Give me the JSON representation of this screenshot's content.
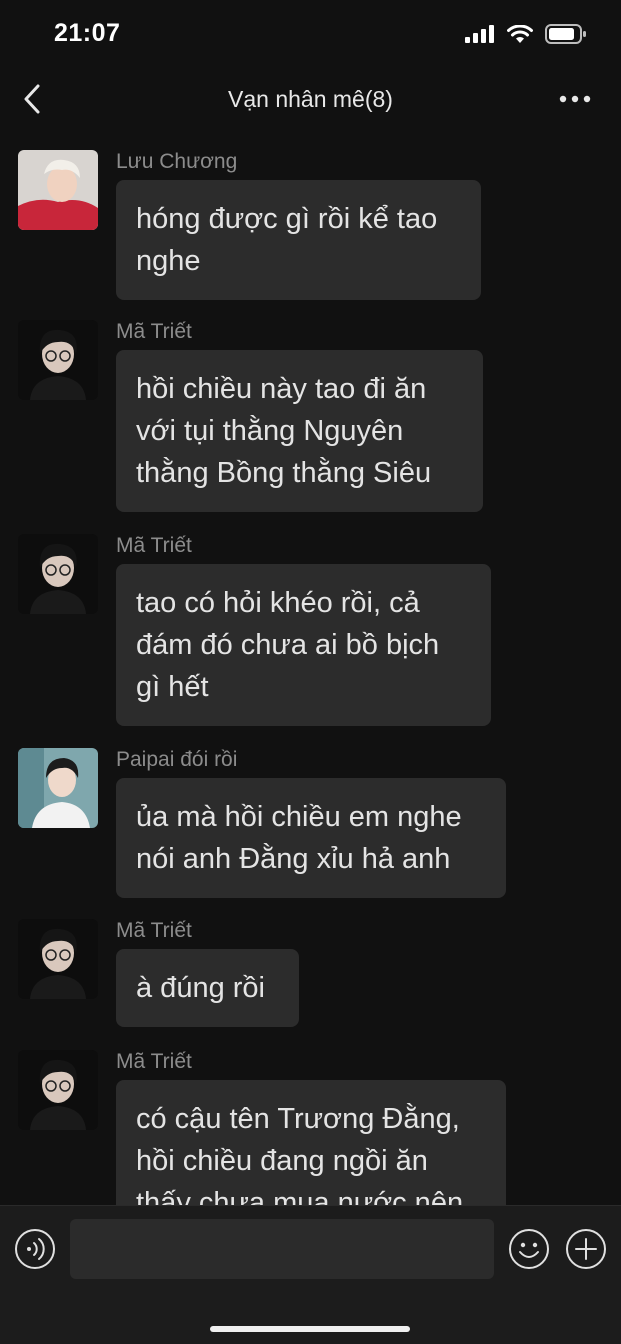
{
  "status_bar": {
    "time": "21:07",
    "icons": [
      "signal-icon",
      "wifi-icon",
      "battery-icon"
    ]
  },
  "nav": {
    "title": "Vạn nhân mê(8)",
    "back_icon": "chevron-left-icon",
    "more_icon": "more-dots-icon"
  },
  "colors": {
    "background": "#111111",
    "bubble": "#2c2c2c",
    "sender_text": "#8c8c8c",
    "message_text": "#e4e4e4",
    "input_bar": "#1c1c1c"
  },
  "messages": [
    {
      "sender": "Lưu Chương",
      "avatar": "avatar-red-hoodie",
      "lines": [
        "hóng được gì rồi kể tao",
        "nghe"
      ]
    },
    {
      "sender": "Mã Triết",
      "avatar": "avatar-glasses",
      "lines": [
        "hồi chiều này tao đi ăn",
        "với tụi thằng Nguyên",
        "thằng Bồng thằng Siêu"
      ]
    },
    {
      "sender": "Mã Triết",
      "avatar": "avatar-glasses",
      "lines": [
        "tao có hỏi khéo rồi, cả",
        "đám đó chưa ai bồ bịch",
        "gì hết"
      ]
    },
    {
      "sender": "Paipai đói rồi",
      "avatar": "avatar-white-shirt",
      "lines": [
        "ủa mà hồi chiều em nghe",
        "nói anh Đằng xỉu hả anh"
      ]
    },
    {
      "sender": "Mã Triết",
      "avatar": "avatar-glasses",
      "lines": [
        "à đúng rồi"
      ]
    },
    {
      "sender": "Mã Triết",
      "avatar": "avatar-glasses",
      "lines": [
        "có cậu tên Trương Đằng,",
        "hồi chiều đang ngồi ăn",
        "thấy chưa mua nước nên"
      ]
    }
  ],
  "input_bar": {
    "placeholder": "",
    "voice_icon": "voice-icon",
    "emoji_icon": "emoji-icon",
    "plus_icon": "plus-icon"
  }
}
